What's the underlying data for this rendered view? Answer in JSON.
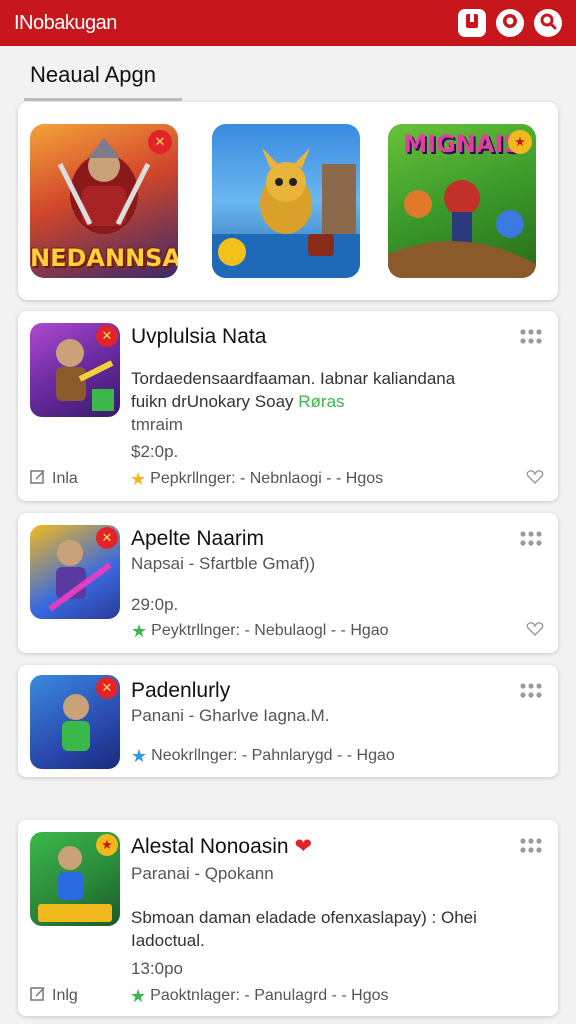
{
  "topbar": {
    "title": "INobakugan",
    "icons": [
      "bookmark-icon",
      "record-icon",
      "search-icon"
    ]
  },
  "section": {
    "label": "Neaual Apgn"
  },
  "carousel": {
    "items": [
      {
        "caption": "NEDANNSAI",
        "badge": "sword-icon"
      },
      {
        "caption": "",
        "badge": ""
      },
      {
        "caption": "MIGNAIS",
        "badge": "star-icon"
      }
    ]
  },
  "cards": [
    {
      "name": "Uvplulsia Nata",
      "desc_line1": "Tordaedensaardfaaman. Iabnar kaliandana",
      "desc_line2": "fuikn drUnokary Soay",
      "desc_green": "Røras",
      "sub": "tmraim",
      "price": "$2:0p.",
      "foot_edit": "Inla",
      "foot_meta": "Pepkrllnger: - Nebnlaogi - - Hgos",
      "star": "yellow"
    },
    {
      "name": "Apelte Naarim",
      "sub": "Napsai - Sfartble Gmaf))",
      "price": "29:0p.",
      "foot_meta": "Peyktrllnger: - Nebulaogl - - Hgao",
      "star": "green"
    },
    {
      "name": "Padenlurly",
      "sub": "Panani - Gharlve Iagna.M.",
      "foot_meta": "Neokrllnger: - Pahnlarygd - - Hgao",
      "star": "blue"
    },
    {
      "name": "Alestal Nonoasin",
      "sub": "Paranai - Qpokann",
      "desc_line1": "Sbmoan daman eladade ofenxaslapay) : Ohei",
      "desc_line2": "Iadoctual.",
      "price": "13:0po",
      "foot_edit": "Inlg",
      "foot_meta": "Paoktnlager: - Panulagrd - - Hgos",
      "star": "green"
    }
  ],
  "colors": {
    "brand": "#c8161d",
    "star_yellow": "#f2b91e",
    "star_green": "#3bb84a",
    "star_blue": "#2d9be0",
    "green_text": "#3bb84a"
  }
}
